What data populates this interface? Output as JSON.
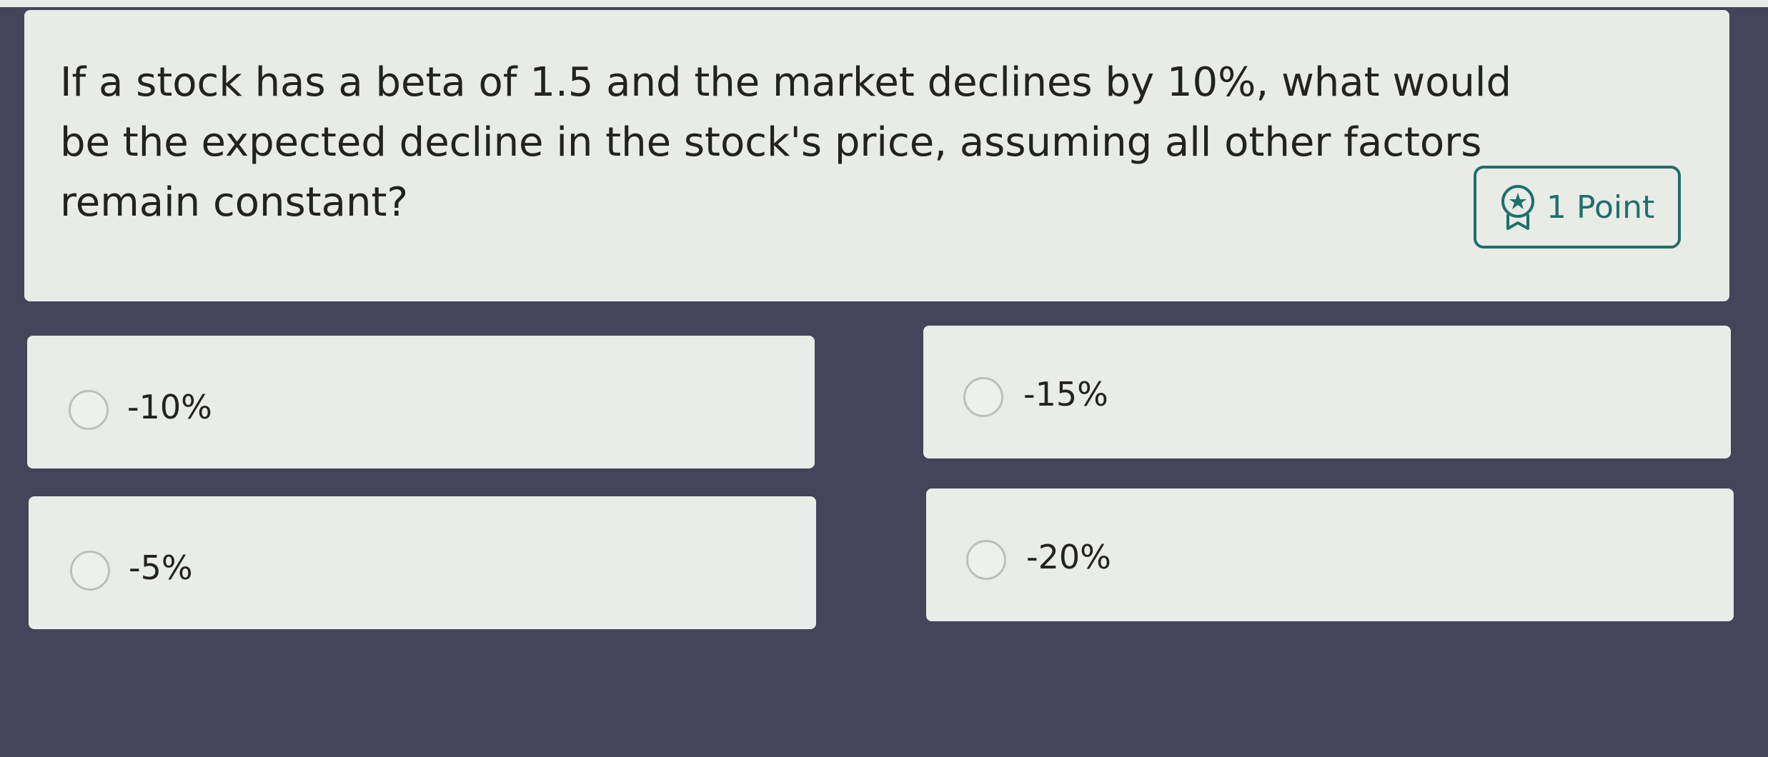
{
  "question": {
    "text": "If a stock has a beta of 1.5 and the market declines by 10%, what would be the expected decline in the stock's price, assuming all other factors remain constant?",
    "points_label": "1 Point"
  },
  "options": [
    {
      "label": "-10%"
    },
    {
      "label": "-15%"
    },
    {
      "label": "-5%"
    },
    {
      "label": "-20%"
    }
  ],
  "colors": {
    "background": "#45445a",
    "card": "#e8ebe6",
    "accent": "#1f6f6b",
    "text": "#222222"
  },
  "icons": {
    "points": "award-ribbon-icon"
  }
}
